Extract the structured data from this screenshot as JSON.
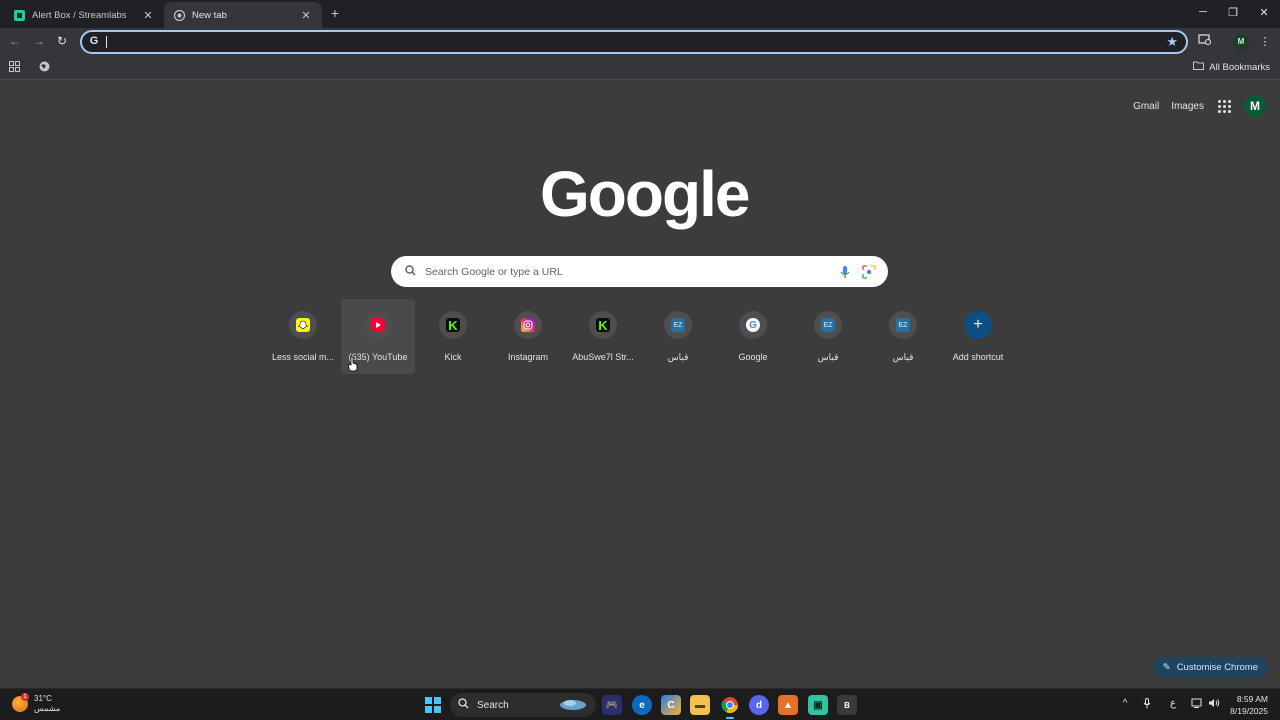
{
  "tabs": [
    {
      "title": "Alert Box / Streamlabs",
      "favicon": "streamlabs-icon",
      "active": false
    },
    {
      "title": "New tab",
      "favicon": "chrome-icon",
      "active": true
    }
  ],
  "window_controls": {
    "minimize": "─",
    "restore": "❐",
    "close": "✕"
  },
  "omnibox": {
    "value": "",
    "placeholder": ""
  },
  "bookmarks": {
    "all_label": "All Bookmarks"
  },
  "ntp": {
    "top_links": {
      "gmail": "Gmail",
      "images": "Images"
    },
    "avatar_letter": "M",
    "logo": "Google",
    "search_placeholder": "Search Google or type a URL",
    "shortcuts": [
      {
        "label": "Less social m...",
        "icon": "snapchat-icon",
        "color": "#FFFC00"
      },
      {
        "label": "(635) YouTube",
        "icon": "youtube-icon",
        "color": "#FF0033"
      },
      {
        "label": "Kick",
        "icon": "kick-icon",
        "color": "#53FC18"
      },
      {
        "label": "Instagram",
        "icon": "instagram-icon",
        "color": "#E1306C"
      },
      {
        "label": "AbuSwe7l Str...",
        "icon": "kick-icon",
        "color": "#53FC18"
      },
      {
        "label": "قياس",
        "icon": "qiyas-icon",
        "color": "#2B6F9E"
      },
      {
        "label": "Google",
        "icon": "google-icon",
        "color": "#4285F4"
      },
      {
        "label": "قياس",
        "icon": "qiyas-icon",
        "color": "#2B6F9E"
      },
      {
        "label": "قياس",
        "icon": "qiyas-icon",
        "color": "#2B6F9E"
      },
      {
        "label": "Add shortcut",
        "icon": "plus-icon",
        "color": "#0B57D0"
      }
    ],
    "customise_label": "Customise Chrome"
  },
  "taskbar": {
    "weather": {
      "temp": "31°C",
      "condition": "مشمس",
      "badge": "1"
    },
    "search_label": "Search",
    "tray": {
      "lang": "ع"
    },
    "clock": {
      "time": "8:59 AM",
      "date": "8/19/2025"
    }
  }
}
